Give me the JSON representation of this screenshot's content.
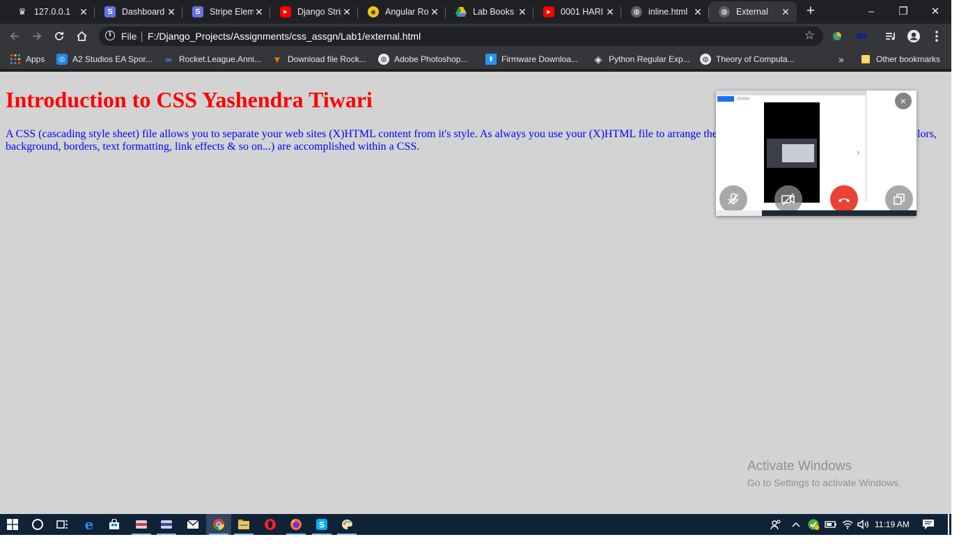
{
  "browser": {
    "tabs": [
      {
        "title": "127.0.0.1",
        "icon": "spinner-icon",
        "color": "#e8eaed"
      },
      {
        "title": "Dashboard",
        "icon": "stripe-icon",
        "color": "#6772e5"
      },
      {
        "title": "Stripe Elem",
        "icon": "stripe-icon",
        "color": "#6772e5"
      },
      {
        "title": "Django Strip",
        "icon": "youtube-icon",
        "color": "#ff0000"
      },
      {
        "title": "Angular Ro",
        "icon": "stackblitz-icon",
        "color": "#f5c518"
      },
      {
        "title": "Lab Books -",
        "icon": "google-drive-icon",
        "color": "#1fa463"
      },
      {
        "title": "0001 HARI",
        "icon": "youtube-icon",
        "color": "#ff0000"
      },
      {
        "title": "inline.html",
        "icon": "globe-icon",
        "color": "#9aa0a6"
      },
      {
        "title": "External",
        "icon": "globe-icon",
        "color": "#9aa0a6"
      }
    ],
    "new_tab_label": "+",
    "window_controls": {
      "minimize": "–",
      "maximize": "❐",
      "close": "✕"
    },
    "omnibox": {
      "scheme": "File",
      "url": "F:/Django_Projects/Assignments/css_assgn/Lab1/external.html"
    },
    "bookmarks": [
      {
        "label": "Apps",
        "icon": "apps-grid-icon",
        "color": "#4285f4"
      },
      {
        "label": "A2 Studios EA Spor...",
        "icon": "a2-studios-icon",
        "color": "#1e88e5"
      },
      {
        "label": "Rocket.League.Anni...",
        "icon": "link-icon",
        "color": "#4f8fe6"
      },
      {
        "label": "Download file Rock...",
        "icon": "download-icon",
        "color": "#f57c00"
      },
      {
        "label": "Adobe Photoshop...",
        "icon": "globe-icon",
        "color": "#e8eaed"
      },
      {
        "label": "Firmware Downloa...",
        "icon": "firmware-icon",
        "color": "#2196f3"
      },
      {
        "label": "Python Regular Exp...",
        "icon": "python-icon",
        "color": "#e8eaed"
      },
      {
        "label": "Theory of Computa...",
        "icon": "globe-icon",
        "color": "#e8eaed"
      }
    ],
    "overflow_label": "»",
    "other_bookmarks": "Other bookmarks"
  },
  "page": {
    "heading": "Introduction to CSS Yashendra Tiwari",
    "paragraph": "A CSS (cascading style sheet) file allows you to separate your web sites (X)HTML content from it's style. As always you use your (X)HTML file to arrange the content, but all of the presentation (fonts, colors, background, borders, text formatting, link effects & so on...) are accomplished within a CSS.",
    "heading_color": "#ff0000",
    "paragraph_color": "#0000ff",
    "background_color": "#d3d3d3"
  },
  "watermark": {
    "title": "Activate Windows",
    "subtitle": "Go to Settings to activate Windows."
  },
  "video_call": {
    "close_label": "×",
    "controls": [
      "mic-off-icon",
      "camera-off-icon",
      "hang-up-icon",
      "popout-icon"
    ]
  },
  "taskbar": {
    "apps": [
      "start-icon",
      "cortana-icon",
      "task-view-icon",
      "edge-icon",
      "store-icon",
      "app-icon",
      "app-icon",
      "mail-icon",
      "chrome-icon",
      "file-explorer-icon",
      "opera-icon",
      "firefox-icon",
      "skype-icon",
      "paint-icon"
    ],
    "clock": "11:19 AM"
  }
}
